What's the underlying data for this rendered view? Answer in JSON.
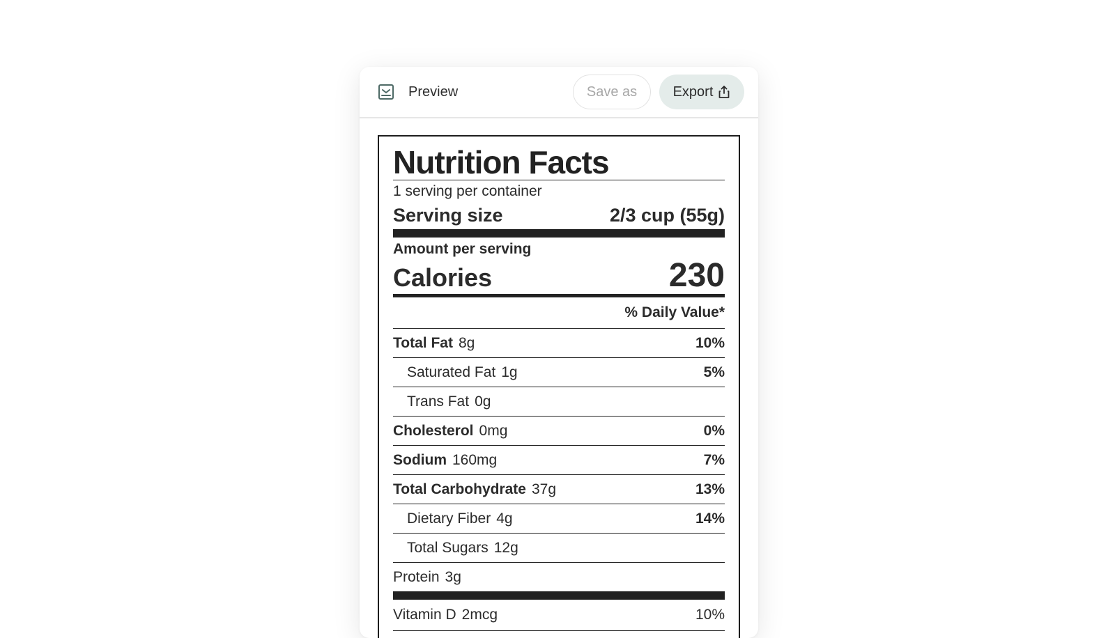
{
  "toolbar": {
    "preview_icon": "preview-icon",
    "title": "Preview",
    "save_label": "Save as",
    "export_label": "Export",
    "export_icon": "share-upload-icon"
  },
  "label": {
    "title": "Nutrition Facts",
    "servings_per_container": "1 serving per container",
    "serving_size_label": "Serving size",
    "serving_size_value": "2/3 cup (55g)",
    "amount_per_serving": "Amount per serving",
    "calories_label": "Calories",
    "calories_value": "230",
    "daily_value_header": "% Daily Value*",
    "nutrients": [
      {
        "name": "Total Fat",
        "amount": "8g",
        "dv": "10%"
      },
      {
        "name": "Saturated Fat",
        "amount": "1g",
        "dv": "5%"
      },
      {
        "name": "Trans Fat",
        "amount": "0g",
        "dv": ""
      },
      {
        "name": "Cholesterol",
        "amount": "0mg",
        "dv": "0%"
      },
      {
        "name": "Sodium",
        "amount": "160mg",
        "dv": "7%"
      },
      {
        "name": "Total Carbohydrate",
        "amount": "37g",
        "dv": "13%"
      },
      {
        "name": "Dietary Fiber",
        "amount": "4g",
        "dv": "14%"
      },
      {
        "name": "Total Sugars",
        "amount": "12g",
        "dv": ""
      },
      {
        "name": "Protein",
        "amount": "3g",
        "dv": ""
      }
    ],
    "vitamins": [
      {
        "name": "Vitamin D",
        "amount": "2mcg",
        "dv": "10%"
      }
    ]
  },
  "colors": {
    "ink": "#222222",
    "export_bg": "#e4ecea",
    "save_text": "#a7a7a7",
    "icon": "#4e6a66"
  }
}
